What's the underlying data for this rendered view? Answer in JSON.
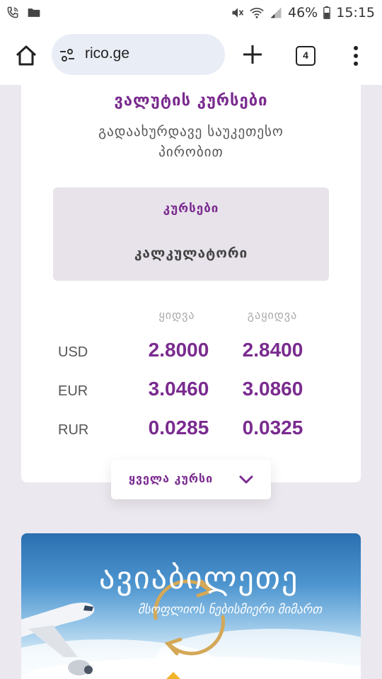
{
  "status_bar": {
    "battery_percent": "46%",
    "time": "15:15"
  },
  "browser": {
    "url": "rico.ge",
    "tab_count": "4"
  },
  "rates": {
    "title": "ვალუტის კურსები",
    "subtitle": "გადაახურდავე საუკეთესო პირობით",
    "tab_rates": "კურსები",
    "tab_calculator": "კალკულატორი",
    "col_buy": "ყიდვა",
    "col_sell": "გაყიდვა",
    "rows": [
      {
        "currency": "USD",
        "buy": "2.8000",
        "sell": "2.8400"
      },
      {
        "currency": "EUR",
        "buy": "3.0460",
        "sell": "3.0860"
      },
      {
        "currency": "RUR",
        "buy": "0.0285",
        "sell": "0.0325"
      }
    ],
    "all_rates_label": "ყველა კურსი"
  },
  "banner": {
    "title": "ავიაბილეთე",
    "subtitle": "მსოფლიოს ნებისმიერი მიმართ"
  },
  "colors": {
    "accent": "#7a2b8f",
    "page_bg": "#ece8ef",
    "tab_bg": "#e8e3eb"
  },
  "icons": [
    "wifi-call-icon",
    "folder-icon",
    "mute-icon",
    "wifi-icon",
    "signal-icon",
    "battery-icon",
    "home-icon",
    "site-settings-icon",
    "plus-icon",
    "tabs-icon",
    "more-vert-icon",
    "chevron-down-icon",
    "airplane-icon",
    "exchange-arrows-icon"
  ]
}
